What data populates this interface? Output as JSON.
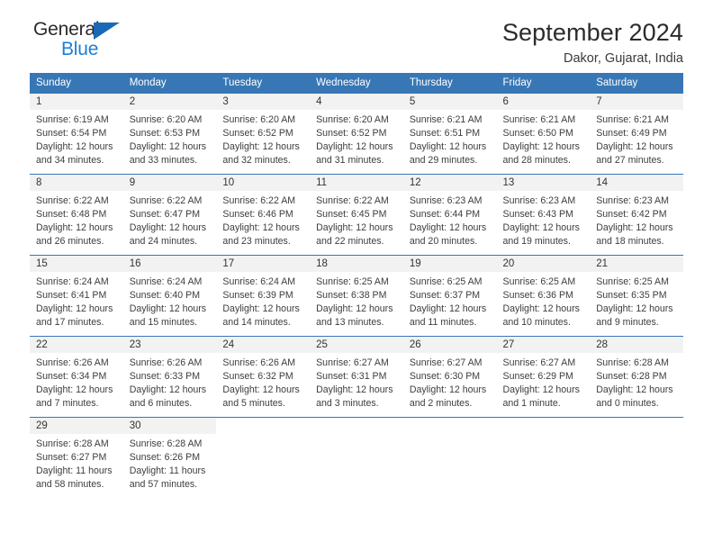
{
  "brand": {
    "name_top": "General",
    "name_bottom": "Blue",
    "triangle_color": "#1a69b5",
    "blue_color": "#1e7fd4"
  },
  "header": {
    "title": "September 2024",
    "subtitle": "Dakor, Gujarat, India"
  },
  "theme": {
    "header_bg": "#3877b5",
    "header_text": "#ffffff",
    "daynum_bg": "#f2f2f2",
    "row_border": "#3877b5"
  },
  "weekday_headers": [
    "Sunday",
    "Monday",
    "Tuesday",
    "Wednesday",
    "Thursday",
    "Friday",
    "Saturday"
  ],
  "labels": {
    "sunrise_prefix": "Sunrise:",
    "sunset_prefix": "Sunset:",
    "daylight_prefix": "Daylight:"
  },
  "weeks": [
    [
      {
        "day": "1",
        "sunrise": "Sunrise: 6:19 AM",
        "sunset": "Sunset: 6:54 PM",
        "daylight_line1": "Daylight: 12 hours",
        "daylight_line2": "and 34 minutes."
      },
      {
        "day": "2",
        "sunrise": "Sunrise: 6:20 AM",
        "sunset": "Sunset: 6:53 PM",
        "daylight_line1": "Daylight: 12 hours",
        "daylight_line2": "and 33 minutes."
      },
      {
        "day": "3",
        "sunrise": "Sunrise: 6:20 AM",
        "sunset": "Sunset: 6:52 PM",
        "daylight_line1": "Daylight: 12 hours",
        "daylight_line2": "and 32 minutes."
      },
      {
        "day": "4",
        "sunrise": "Sunrise: 6:20 AM",
        "sunset": "Sunset: 6:52 PM",
        "daylight_line1": "Daylight: 12 hours",
        "daylight_line2": "and 31 minutes."
      },
      {
        "day": "5",
        "sunrise": "Sunrise: 6:21 AM",
        "sunset": "Sunset: 6:51 PM",
        "daylight_line1": "Daylight: 12 hours",
        "daylight_line2": "and 29 minutes."
      },
      {
        "day": "6",
        "sunrise": "Sunrise: 6:21 AM",
        "sunset": "Sunset: 6:50 PM",
        "daylight_line1": "Daylight: 12 hours",
        "daylight_line2": "and 28 minutes."
      },
      {
        "day": "7",
        "sunrise": "Sunrise: 6:21 AM",
        "sunset": "Sunset: 6:49 PM",
        "daylight_line1": "Daylight: 12 hours",
        "daylight_line2": "and 27 minutes."
      }
    ],
    [
      {
        "day": "8",
        "sunrise": "Sunrise: 6:22 AM",
        "sunset": "Sunset: 6:48 PM",
        "daylight_line1": "Daylight: 12 hours",
        "daylight_line2": "and 26 minutes."
      },
      {
        "day": "9",
        "sunrise": "Sunrise: 6:22 AM",
        "sunset": "Sunset: 6:47 PM",
        "daylight_line1": "Daylight: 12 hours",
        "daylight_line2": "and 24 minutes."
      },
      {
        "day": "10",
        "sunrise": "Sunrise: 6:22 AM",
        "sunset": "Sunset: 6:46 PM",
        "daylight_line1": "Daylight: 12 hours",
        "daylight_line2": "and 23 minutes."
      },
      {
        "day": "11",
        "sunrise": "Sunrise: 6:22 AM",
        "sunset": "Sunset: 6:45 PM",
        "daylight_line1": "Daylight: 12 hours",
        "daylight_line2": "and 22 minutes."
      },
      {
        "day": "12",
        "sunrise": "Sunrise: 6:23 AM",
        "sunset": "Sunset: 6:44 PM",
        "daylight_line1": "Daylight: 12 hours",
        "daylight_line2": "and 20 minutes."
      },
      {
        "day": "13",
        "sunrise": "Sunrise: 6:23 AM",
        "sunset": "Sunset: 6:43 PM",
        "daylight_line1": "Daylight: 12 hours",
        "daylight_line2": "and 19 minutes."
      },
      {
        "day": "14",
        "sunrise": "Sunrise: 6:23 AM",
        "sunset": "Sunset: 6:42 PM",
        "daylight_line1": "Daylight: 12 hours",
        "daylight_line2": "and 18 minutes."
      }
    ],
    [
      {
        "day": "15",
        "sunrise": "Sunrise: 6:24 AM",
        "sunset": "Sunset: 6:41 PM",
        "daylight_line1": "Daylight: 12 hours",
        "daylight_line2": "and 17 minutes."
      },
      {
        "day": "16",
        "sunrise": "Sunrise: 6:24 AM",
        "sunset": "Sunset: 6:40 PM",
        "daylight_line1": "Daylight: 12 hours",
        "daylight_line2": "and 15 minutes."
      },
      {
        "day": "17",
        "sunrise": "Sunrise: 6:24 AM",
        "sunset": "Sunset: 6:39 PM",
        "daylight_line1": "Daylight: 12 hours",
        "daylight_line2": "and 14 minutes."
      },
      {
        "day": "18",
        "sunrise": "Sunrise: 6:25 AM",
        "sunset": "Sunset: 6:38 PM",
        "daylight_line1": "Daylight: 12 hours",
        "daylight_line2": "and 13 minutes."
      },
      {
        "day": "19",
        "sunrise": "Sunrise: 6:25 AM",
        "sunset": "Sunset: 6:37 PM",
        "daylight_line1": "Daylight: 12 hours",
        "daylight_line2": "and 11 minutes."
      },
      {
        "day": "20",
        "sunrise": "Sunrise: 6:25 AM",
        "sunset": "Sunset: 6:36 PM",
        "daylight_line1": "Daylight: 12 hours",
        "daylight_line2": "and 10 minutes."
      },
      {
        "day": "21",
        "sunrise": "Sunrise: 6:25 AM",
        "sunset": "Sunset: 6:35 PM",
        "daylight_line1": "Daylight: 12 hours",
        "daylight_line2": "and 9 minutes."
      }
    ],
    [
      {
        "day": "22",
        "sunrise": "Sunrise: 6:26 AM",
        "sunset": "Sunset: 6:34 PM",
        "daylight_line1": "Daylight: 12 hours",
        "daylight_line2": "and 7 minutes."
      },
      {
        "day": "23",
        "sunrise": "Sunrise: 6:26 AM",
        "sunset": "Sunset: 6:33 PM",
        "daylight_line1": "Daylight: 12 hours",
        "daylight_line2": "and 6 minutes."
      },
      {
        "day": "24",
        "sunrise": "Sunrise: 6:26 AM",
        "sunset": "Sunset: 6:32 PM",
        "daylight_line1": "Daylight: 12 hours",
        "daylight_line2": "and 5 minutes."
      },
      {
        "day": "25",
        "sunrise": "Sunrise: 6:27 AM",
        "sunset": "Sunset: 6:31 PM",
        "daylight_line1": "Daylight: 12 hours",
        "daylight_line2": "and 3 minutes."
      },
      {
        "day": "26",
        "sunrise": "Sunrise: 6:27 AM",
        "sunset": "Sunset: 6:30 PM",
        "daylight_line1": "Daylight: 12 hours",
        "daylight_line2": "and 2 minutes."
      },
      {
        "day": "27",
        "sunrise": "Sunrise: 6:27 AM",
        "sunset": "Sunset: 6:29 PM",
        "daylight_line1": "Daylight: 12 hours",
        "daylight_line2": "and 1 minute."
      },
      {
        "day": "28",
        "sunrise": "Sunrise: 6:28 AM",
        "sunset": "Sunset: 6:28 PM",
        "daylight_line1": "Daylight: 12 hours",
        "daylight_line2": "and 0 minutes."
      }
    ],
    [
      {
        "day": "29",
        "sunrise": "Sunrise: 6:28 AM",
        "sunset": "Sunset: 6:27 PM",
        "daylight_line1": "Daylight: 11 hours",
        "daylight_line2": "and 58 minutes."
      },
      {
        "day": "30",
        "sunrise": "Sunrise: 6:28 AM",
        "sunset": "Sunset: 6:26 PM",
        "daylight_line1": "Daylight: 11 hours",
        "daylight_line2": "and 57 minutes."
      },
      {
        "day": "",
        "sunrise": "",
        "sunset": "",
        "daylight_line1": "",
        "daylight_line2": ""
      },
      {
        "day": "",
        "sunrise": "",
        "sunset": "",
        "daylight_line1": "",
        "daylight_line2": ""
      },
      {
        "day": "",
        "sunrise": "",
        "sunset": "",
        "daylight_line1": "",
        "daylight_line2": ""
      },
      {
        "day": "",
        "sunrise": "",
        "sunset": "",
        "daylight_line1": "",
        "daylight_line2": ""
      },
      {
        "day": "",
        "sunrise": "",
        "sunset": "",
        "daylight_line1": "",
        "daylight_line2": ""
      }
    ]
  ]
}
